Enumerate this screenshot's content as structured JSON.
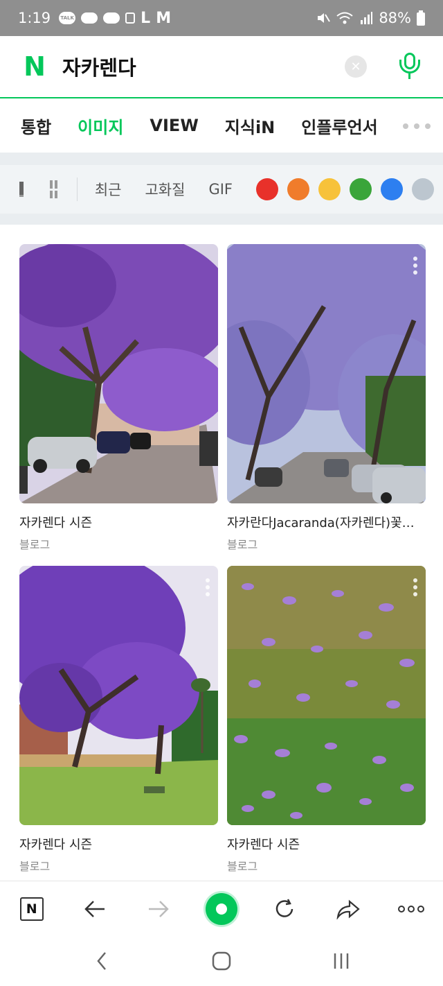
{
  "status_bar": {
    "time": "1:19",
    "talk_badge": "TALK",
    "letters": [
      "L",
      "M"
    ],
    "battery": "88%"
  },
  "search": {
    "logo": "N",
    "query": "자카렌다",
    "clear_icon": "close-icon",
    "mic_icon": "mic-icon"
  },
  "tabs": [
    "통합",
    "이미지",
    "VIEW",
    "지식iN",
    "인플루언서"
  ],
  "active_tab": "이미지",
  "filters": {
    "items": [
      "최근",
      "고화질",
      "GIF"
    ],
    "color_swatches": [
      "#e8312a",
      "#f07c2b",
      "#f7c23a",
      "#3aa53a",
      "#2d7ff0"
    ]
  },
  "results": [
    {
      "title": "자카렌다 시즌",
      "source": "블로그"
    },
    {
      "title": "자카란다Jacaranda(자카렌다)꽃길 …",
      "source": "블로그"
    },
    {
      "title": "자카렌다 시즌",
      "source": "블로그"
    },
    {
      "title": "자카렌다 시즌",
      "source": "블로그"
    }
  ],
  "toolbar": {
    "home_label": "N",
    "icons": [
      "naver-home-icon",
      "back-arrow-icon",
      "forward-arrow-icon",
      "green-dot-icon",
      "refresh-icon",
      "share-icon",
      "more-icon"
    ]
  },
  "system_nav": [
    "back-icon",
    "home-icon",
    "recents-icon"
  ]
}
